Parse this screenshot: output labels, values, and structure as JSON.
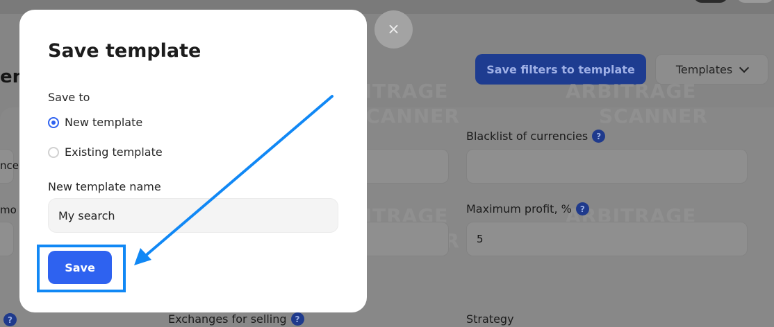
{
  "background": {
    "heading_fragment": "en",
    "save_filters_button": "Save filters to template",
    "templates_dropdown": {
      "label": "Templates",
      "icon": "chevron-down-icon"
    },
    "labels": {
      "blacklist_currencies": "Blacklist of currencies",
      "maximum_profit": "Maximum profit, %",
      "exchanges_for_selling": "Exchanges for selling",
      "strategy": "Strategy"
    },
    "left_fragments": {
      "row1": "nce",
      "row2": "mo"
    },
    "maximum_profit_value": "5",
    "help_glyph": "?",
    "watermark": {
      "line1": "ARBITRAGE",
      "line2": "SCANNER"
    }
  },
  "modal": {
    "close_glyph": "×",
    "title": "Save template",
    "save_to_label": "Save to",
    "options": [
      {
        "label": "New template",
        "checked": true
      },
      {
        "label": "Existing template",
        "checked": false
      }
    ],
    "name_label": "New template name",
    "name_value": "My search",
    "save_button": "Save"
  },
  "colors": {
    "accent": "#2e62f0",
    "annotation": "#1188f5"
  }
}
